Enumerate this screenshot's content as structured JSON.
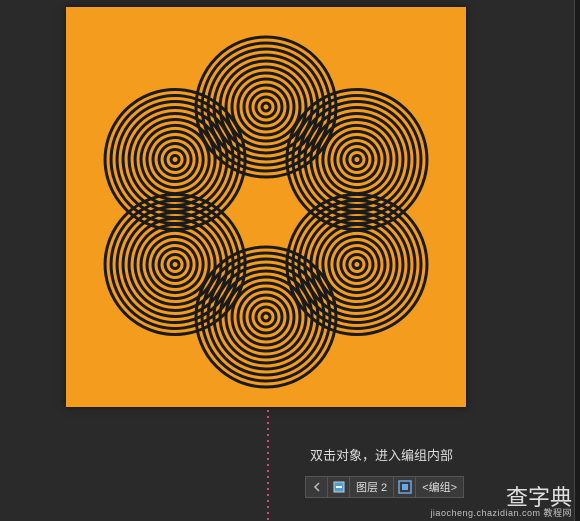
{
  "canvas": {
    "background": "#f39c1e",
    "pattern_color": "#1a1a1a"
  },
  "annotation": {
    "text": "双击对象，进入编组内部"
  },
  "layer_bar": {
    "layer_label": "图层 2",
    "group_label": "<编组>"
  },
  "watermark": {
    "main": "查字典",
    "sub": "jiaocheng.chazidian.com 教程网"
  }
}
